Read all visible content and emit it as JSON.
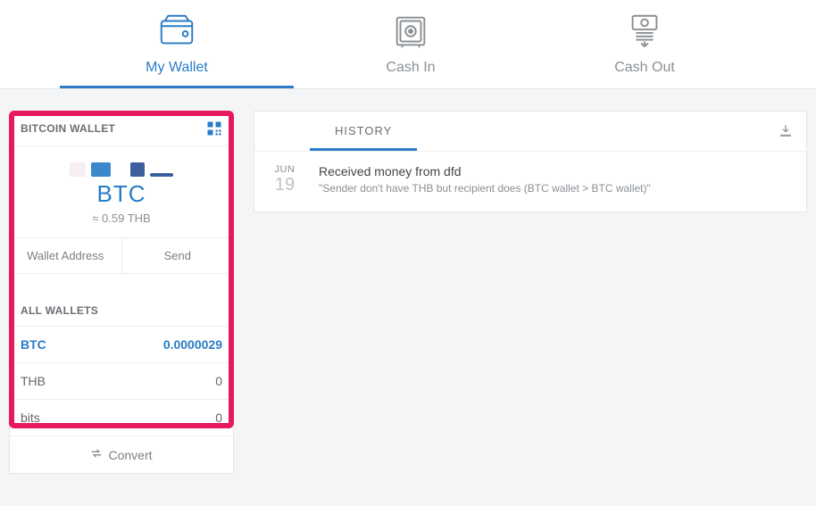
{
  "nav": {
    "items": [
      {
        "label": "My Wallet"
      },
      {
        "label": "Cash In"
      },
      {
        "label": "Cash Out"
      }
    ]
  },
  "wallet_card": {
    "title": "BITCOIN WALLET",
    "currency": "BTC",
    "fiat": "≈ 0.59 THB",
    "actions": {
      "address": "Wallet Address",
      "send": "Send"
    }
  },
  "all_wallets": {
    "title": "ALL WALLETS",
    "rows": [
      {
        "name": "BTC",
        "value": "0.0000029",
        "active": true
      },
      {
        "name": "THB",
        "value": "0"
      },
      {
        "name": "bits",
        "value": "0"
      }
    ],
    "convert_label": "Convert"
  },
  "history": {
    "tab_label": "HISTORY",
    "items": [
      {
        "month": "JUN",
        "day": "19",
        "title": "Received money from dfd",
        "note": "\"Sender don't have THB but recipient does (BTC wallet > BTC wallet)\""
      }
    ]
  }
}
